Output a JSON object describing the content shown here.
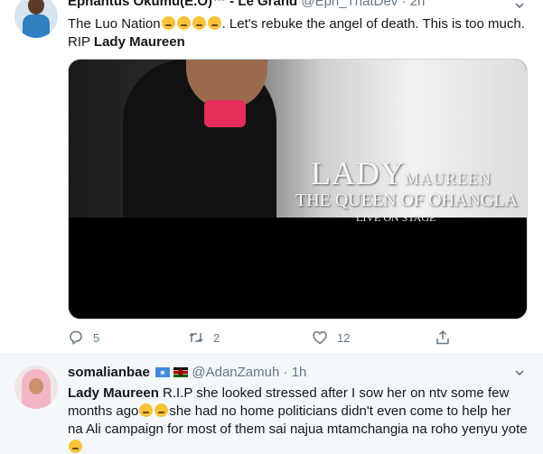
{
  "tweets": [
    {
      "display_name": "Ephantus Okumu(E.O)™ - Le Grand",
      "handle": "@Eph_ThatDev",
      "dot": "·",
      "time": "2h",
      "text_before": "The Luo Nation",
      "emojis": [
        "😣",
        "😣",
        "😣",
        "😣"
      ],
      "text_after": ". Let's rebuke the angel of death. This is too much. RIP",
      "mention_bold": "Lady Maureen",
      "media": {
        "title_lady": "LADY",
        "title_maureen": "MAUREEN",
        "subtitle": "THE QUEEN OF OHANGLA",
        "banner": "LIVE ON STAGE"
      },
      "counts": {
        "replies": "5",
        "retweets": "2",
        "likes": "12"
      }
    },
    {
      "display_name": "somalianbae",
      "flags": [
        "somalia-flag",
        "kenya-flag"
      ],
      "handle": "@AdanZamuh",
      "dot": "·",
      "time": "1h",
      "bold_start": "Lady Maureen",
      "text_1": " R.I.P she looked stressed after I sow her on ntv some few months ago",
      "text_2": "she had no home politicians didn't even come to help her na Ali campaign for most of them sai najua mtamchangia na roho yenyu yote"
    }
  ],
  "icons": [
    "reply-icon",
    "retweet-icon",
    "like-icon",
    "share-icon",
    "chevron-down-icon"
  ],
  "colors": {
    "muted": "#657786",
    "text": "#14171a",
    "background_alt": "#f5f8fa",
    "accent": "#1da1f2"
  }
}
